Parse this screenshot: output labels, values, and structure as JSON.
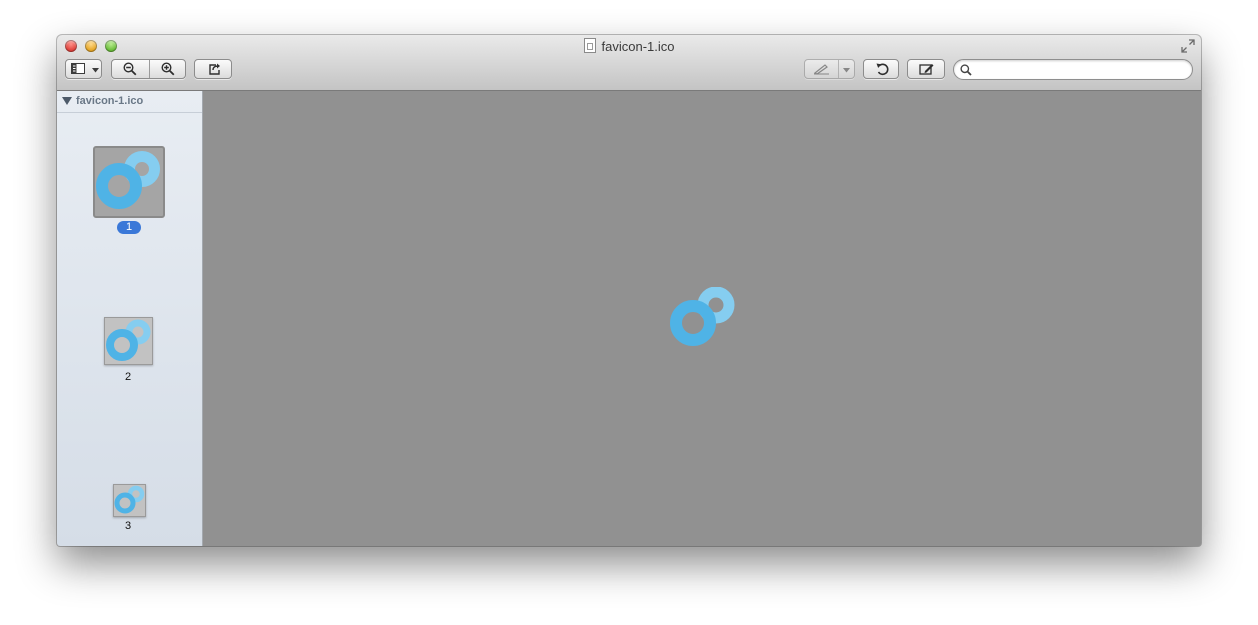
{
  "window": {
    "title": "favicon-1.ico"
  },
  "toolbar": {
    "sidebar_view_button": "sidebar-view",
    "zoom_out": "zoom-out",
    "zoom_in": "zoom-in",
    "share": "share",
    "annotate": "annotate",
    "rotate": "rotate",
    "edit": "edit"
  },
  "search": {
    "placeholder": "",
    "value": ""
  },
  "sidebar": {
    "header": "favicon-1.ico",
    "pages": [
      {
        "label": "1",
        "selected": true
      },
      {
        "label": "2",
        "selected": false
      },
      {
        "label": "3",
        "selected": false
      }
    ]
  },
  "colors": {
    "ring_dark": "#4fb3e6",
    "ring_light": "#85cdf0",
    "content_bg": "#919191",
    "badge": "#3a78d8"
  }
}
